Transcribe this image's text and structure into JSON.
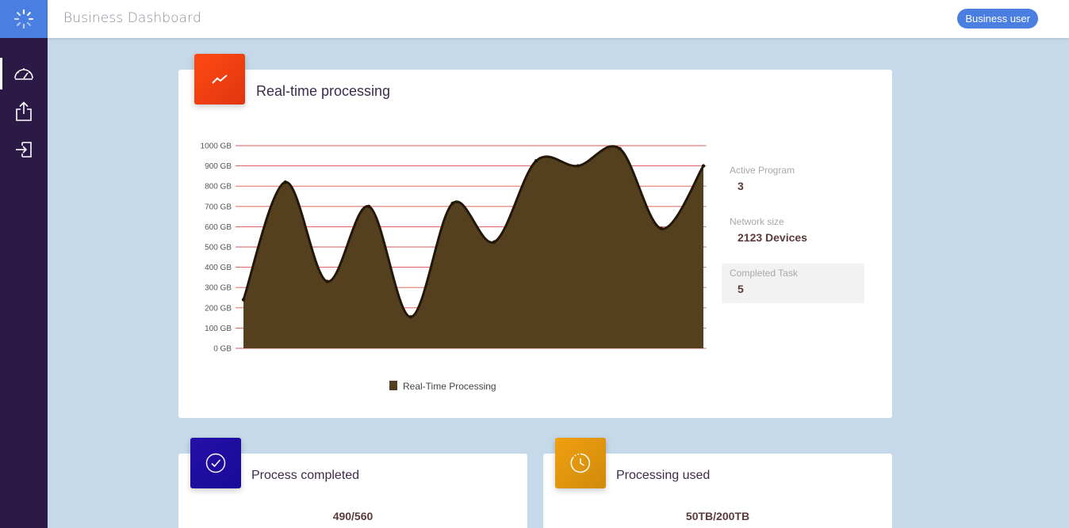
{
  "app": {
    "title": "Business Dashboard",
    "user_label": "Business user"
  },
  "colors": {
    "accent": "#4a7ee0",
    "sidebar": "#2a1a45",
    "area_fill": "#54401f",
    "grid": "#d9534f",
    "background": "#c5d9ea"
  },
  "sidebar": {
    "items": [
      {
        "icon": "dashboard-gauge-icon",
        "active": true
      },
      {
        "icon": "share-export-icon",
        "active": false
      },
      {
        "icon": "sign-in-icon",
        "active": false
      }
    ]
  },
  "processing_card": {
    "title": "Real-time processing",
    "icon": "trending-line-icon",
    "stats": [
      {
        "label": "Active Program",
        "value": "3"
      },
      {
        "label": "Network size",
        "value": "2123 Devices"
      },
      {
        "label": "Completed Task",
        "value": "5"
      }
    ]
  },
  "chart_data": {
    "type": "area",
    "title": "",
    "xlabel": "",
    "ylabel": "",
    "ylim": [
      0,
      1000
    ],
    "y_ticks": [
      "0 GB",
      "100 GB",
      "200 GB",
      "300 GB",
      "400 GB",
      "500 GB",
      "600 GB",
      "700 GB",
      "800 GB",
      "900 GB",
      "1000 GB"
    ],
    "grid": "horizontal",
    "legend_position": "bottom",
    "series": [
      {
        "name": "Real-Time Processing",
        "color": "#54401f",
        "values": [
          240,
          820,
          330,
          700,
          155,
          715,
          525,
          925,
          900,
          985,
          590,
          900
        ]
      }
    ]
  },
  "process_card": {
    "title": "Process completed",
    "value": "490/560",
    "icon": "check-circle-icon"
  },
  "usage_card": {
    "title": "Processing used",
    "value": "50TB/200TB",
    "icon": "clock-history-icon"
  }
}
